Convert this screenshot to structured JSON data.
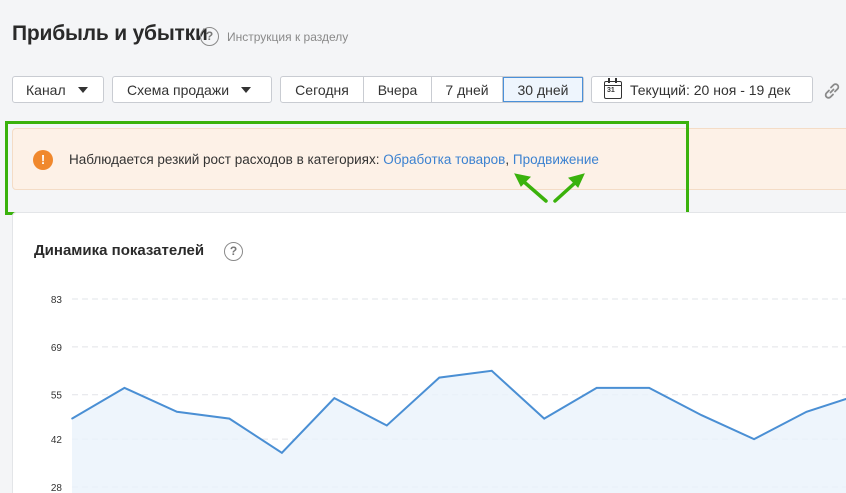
{
  "header": {
    "title": "Прибыль и убытки",
    "instruction_link": "Инструкция к разделу"
  },
  "toolbar": {
    "channel_label": "Канал",
    "scheme_label": "Схема продажи",
    "periods": [
      {
        "label": "Сегодня",
        "active": false
      },
      {
        "label": "Вчера",
        "active": false
      },
      {
        "label": "7 дней",
        "active": false
      },
      {
        "label": "30 дней",
        "active": true
      }
    ],
    "date_range_label": "Текущий: 20 ноя - 19 дек",
    "calendar_day": "31"
  },
  "alert": {
    "text": "Наблюдается резкий рост расходов в категориях:",
    "links": [
      "Обработка товаров",
      "Продвижение"
    ],
    "separator": ","
  },
  "card": {
    "title": "Динамика показателей"
  },
  "colors": {
    "accent": "#3c82d0",
    "line": "#4a8fd4",
    "alert_bg": "#fdf1e7",
    "alert_icon": "#f0882d",
    "annotation": "#3ab20c"
  },
  "chart_data": {
    "type": "line",
    "y_ticks": [
      83,
      69,
      55,
      42,
      28
    ],
    "ylim": [
      28,
      83
    ],
    "x": [
      0,
      1,
      2,
      3,
      4,
      5,
      6,
      7,
      8,
      9,
      10,
      11,
      12,
      13,
      14,
      15
    ],
    "values": [
      48,
      57,
      50,
      48,
      38,
      54,
      46,
      60,
      62,
      48,
      57,
      57,
      49,
      42,
      50,
      55
    ],
    "grid": true
  }
}
